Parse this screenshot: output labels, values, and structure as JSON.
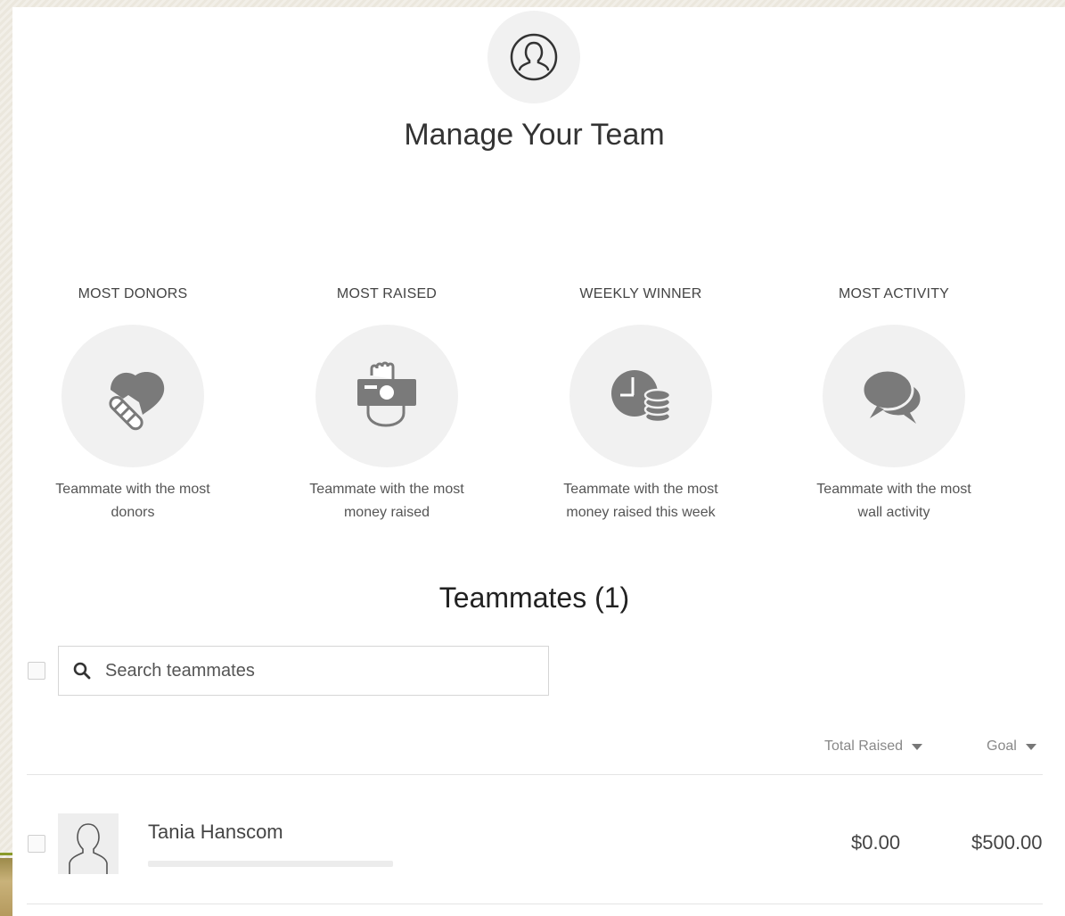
{
  "header": {
    "title": "Manage Your Team",
    "icon": "user-circle-icon"
  },
  "awards": [
    {
      "title": "MOST DONORS",
      "icon": "handshake-icon",
      "desc_line1": "Teammate with the most",
      "desc_line2": "donors"
    },
    {
      "title": "MOST RAISED",
      "icon": "money-hand-icon",
      "desc_line1": "Teammate with the most",
      "desc_line2": "money raised"
    },
    {
      "title": "WEEKLY WINNER",
      "icon": "clock-coins-icon",
      "desc_line1": "Teammate with the most",
      "desc_line2": "money raised this week"
    },
    {
      "title": "MOST ACTIVITY",
      "icon": "chat-bubbles-icon",
      "desc_line1": "Teammate with the most",
      "desc_line2": "wall activity"
    }
  ],
  "teammates": {
    "heading": "Teammates (1)",
    "search_placeholder": "Search teammates",
    "columns": {
      "total_raised": "Total Raised",
      "goal": "Goal"
    },
    "rows": [
      {
        "name": "Tania Hanscom",
        "total_raised": "$0.00",
        "goal": "$500.00",
        "progress": 0
      }
    ]
  },
  "colors": {
    "icon_gray": "#7a7a7a",
    "circle_bg": "#f1f1f1",
    "progress_fill": "#8ab03a"
  }
}
